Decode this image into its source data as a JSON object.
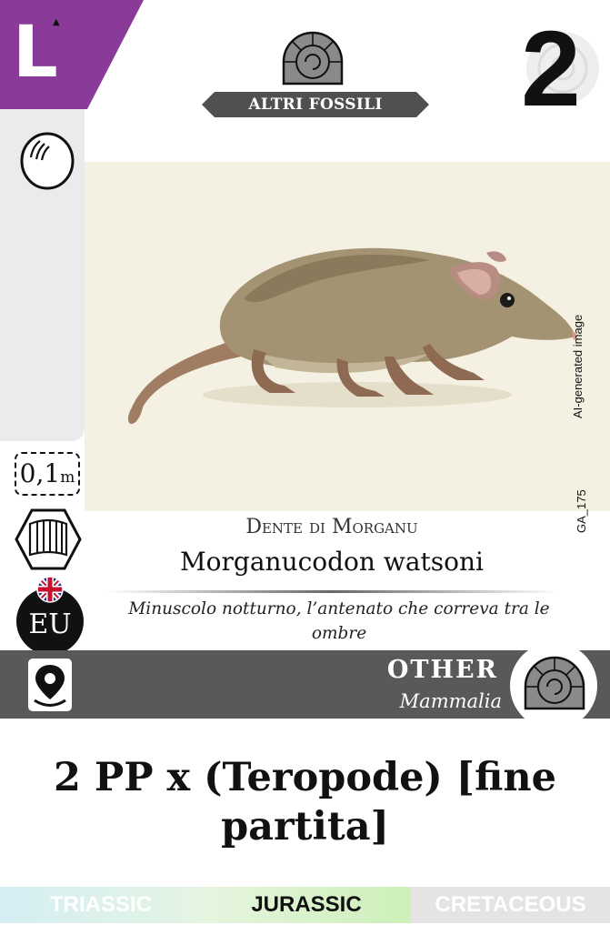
{
  "card": {
    "size_class": "L",
    "category": "ALTRI FOSSILI",
    "points": "2",
    "ai_label": "AI-generated image",
    "card_code": "GA_175",
    "common_name": "Dente di Morganu",
    "scientific_name": "Morganucodon watsoni",
    "flavor_text": "Minuscolo notturno, l’antenato che correva tra le ombre",
    "length": {
      "value": "0,1",
      "unit": "m"
    },
    "region": "EU",
    "group": "OTHER",
    "taxon": "Mammalia",
    "ability": "2 PP x (Teropode) [fine partita]",
    "periods": [
      {
        "label": "TRIASSIC",
        "active": false
      },
      {
        "label": "JURASSIC",
        "active": true
      },
      {
        "label": "CRETACEOUS",
        "active": false
      }
    ]
  },
  "icons": {
    "reproduction": "egg-icon",
    "habitat": "book-icon",
    "flag": "uk-flag-icon",
    "location": "map-pin-icon",
    "category": "ammonite-icon"
  },
  "colors": {
    "size_badge": "#8a3a98",
    "bar": "#595959",
    "banner": "#505050",
    "fossil_grey": "#8a8a8a",
    "illustration_bg": "#f5f1e2"
  }
}
